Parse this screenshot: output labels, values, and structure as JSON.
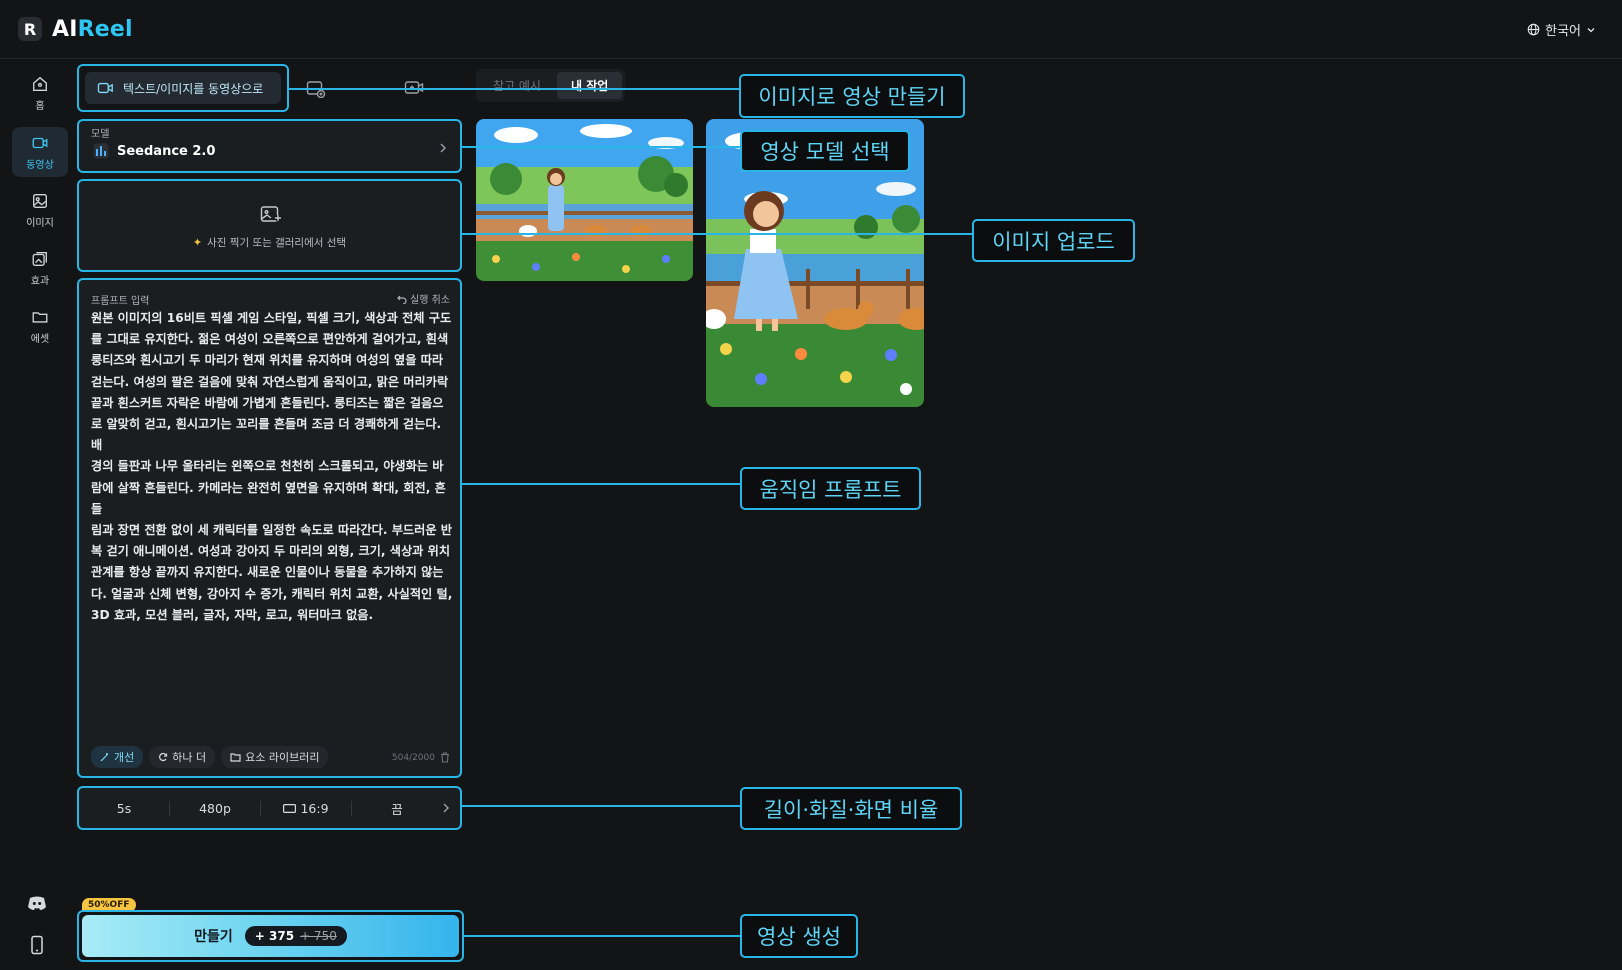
{
  "app": {
    "logo_letter": "R",
    "name_a": "AI",
    "name_b": "Reel",
    "language": "한국어"
  },
  "sidebar": {
    "items": [
      {
        "label": "홈",
        "icon": "home-icon"
      },
      {
        "label": "동영상",
        "icon": "video-icon",
        "active": true
      },
      {
        "label": "이미지",
        "icon": "image-icon"
      },
      {
        "label": "효과",
        "icon": "effects-icon"
      },
      {
        "label": "에셋",
        "icon": "folder-icon"
      }
    ],
    "bottom_icons": [
      "discord-icon",
      "mobile-icon"
    ]
  },
  "toolbar": {
    "mode_tab": "텍스트/이미지를 동영상으로",
    "segment": [
      "참고 예시",
      "내 작업"
    ]
  },
  "model": {
    "label": "모델",
    "name": "Seedance 2.0"
  },
  "upload": {
    "hint": "사진 찍기 또는 갤러리에서 선택"
  },
  "prompt": {
    "label": "프롬프트 입력",
    "undo": "실행 취소",
    "lines": [
      "원본 이미지의 16비트 픽셀 게임 스타일, 픽셀 크기, 색상과 전체 구도",
      "를 그대로 유지한다. 젊은 여성이 오른쪽으로 편안하게 걸어가고, 흰색",
      "룽티즈와 흰시고기 두 마리가 현재 위치를 유지하며 여성의 옆을 따라",
      "걷는다. 여성의 팔은 걸음에 맞춰 자연스럽게 움직이고, 맑은 머리카락",
      "끝과 흰스커트 자락은 바람에 가볍게 흔들린다. 룽티즈는 짧은 걸음으",
      "로 알맞히 걷고, 흰시고기는 꼬리를 흔들며 조금 더 경쾌하게 걷는다. 배",
      "경의 들판과 나무 울타리는 왼쪽으로 천천히 스크롤되고, 야생화는 바",
      "람에 살짝 흔들린다. 카메라는 완전히 옆면을 유지하며 확대, 회전, 흔들",
      "림과 장면 전환 없이 세 캐릭터를 일정한 속도로 따라간다. 부드러운 반",
      "복 걷기 애니메이션. 여성과 강아지 두 마리의 외형, 크기, 색상과 위치",
      "관계를 항상 끝까지 유지한다. 새로운 인물이나 동물을 추가하지 않는",
      "다. 얼굴과 신체 변형, 강아지 수 증가, 캐릭터 위치 교환, 사실적인 털,",
      "3D 효과, 모션 블러, 글자, 자막, 로고, 워터마크 없음."
    ],
    "chips": [
      "개선",
      "하나 더",
      "요소 라이브러리"
    ],
    "counter": "504/2000"
  },
  "settings": {
    "duration": "5s",
    "resolution": "480p",
    "ratio": "16:9",
    "extra": "끔"
  },
  "generate": {
    "badge": "50%OFF",
    "label": "만들기",
    "credit": "+ 375",
    "old_credit": "+ 750"
  },
  "callouts": {
    "image_to_video": "이미지로 영상 만들기",
    "model_select": "영상 모델 선택",
    "image_upload": "이미지 업로드",
    "motion_prompt": "움직임 프롬프트",
    "length_quality_ratio": "길이·화질·화면 비율",
    "generate_video": "영상 생성"
  },
  "colors": {
    "accent": "#29b6e6",
    "background": "#121416",
    "panel": "#1b1e21"
  }
}
